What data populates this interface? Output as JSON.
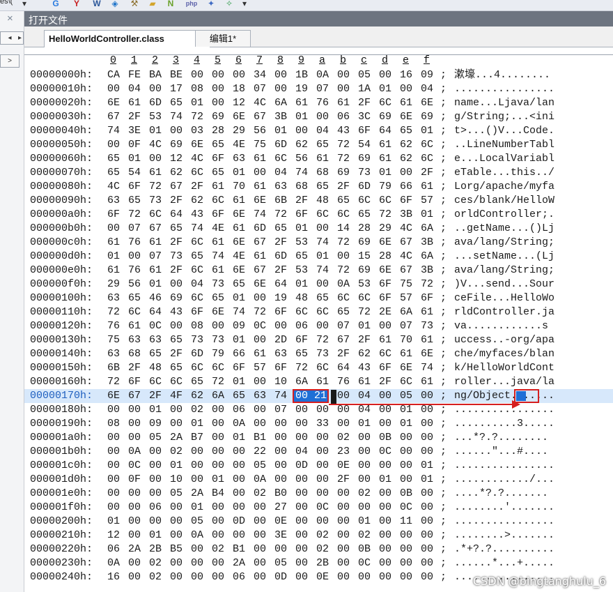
{
  "toolbar": {
    "combo_text": "es\\(",
    "icons": [
      "dropdown-arrow-icon",
      "google-icon",
      "youdao-icon",
      "word-icon",
      "ie-icon",
      "hammer-icon",
      "folder-icon",
      "n-icon",
      "php-icon",
      "plugin-icon",
      "wizard-icon",
      "dropdown-arrow-icon"
    ]
  },
  "left_strip": {
    "close_glyph": "×",
    "btn1": "◂",
    "btn2": "▸",
    "btn3": ">"
  },
  "panel": {
    "title": "打开文件"
  },
  "tabs": [
    {
      "label": "HelloWorldController.class",
      "close": "×"
    },
    {
      "label": "编辑1*"
    }
  ],
  "hex": {
    "column_headers": [
      "0",
      "1",
      "2",
      "3",
      "4",
      "5",
      "6",
      "7",
      "8",
      "9",
      "a",
      "b",
      "c",
      "d",
      "e",
      "f"
    ],
    "highlight_row": 23,
    "rows": [
      {
        "addr": "00000000h:",
        "bytes": [
          "CA",
          "FE",
          "BA",
          "BE",
          "00",
          "00",
          "00",
          "34",
          "00",
          "1B",
          "0A",
          "00",
          "05",
          "00",
          "16",
          "09"
        ],
        "ascii": "漱壕...4........"
      },
      {
        "addr": "00000010h:",
        "bytes": [
          "00",
          "04",
          "00",
          "17",
          "08",
          "00",
          "18",
          "07",
          "00",
          "19",
          "07",
          "00",
          "1A",
          "01",
          "00",
          "04"
        ],
        "ascii": "................"
      },
      {
        "addr": "00000020h:",
        "bytes": [
          "6E",
          "61",
          "6D",
          "65",
          "01",
          "00",
          "12",
          "4C",
          "6A",
          "61",
          "76",
          "61",
          "2F",
          "6C",
          "61",
          "6E"
        ],
        "ascii": "name...Ljava/lan"
      },
      {
        "addr": "00000030h:",
        "bytes": [
          "67",
          "2F",
          "53",
          "74",
          "72",
          "69",
          "6E",
          "67",
          "3B",
          "01",
          "00",
          "06",
          "3C",
          "69",
          "6E",
          "69"
        ],
        "ascii": "g/String;...<ini"
      },
      {
        "addr": "00000040h:",
        "bytes": [
          "74",
          "3E",
          "01",
          "00",
          "03",
          "28",
          "29",
          "56",
          "01",
          "00",
          "04",
          "43",
          "6F",
          "64",
          "65",
          "01"
        ],
        "ascii": "t>...()V...Code."
      },
      {
        "addr": "00000050h:",
        "bytes": [
          "00",
          "0F",
          "4C",
          "69",
          "6E",
          "65",
          "4E",
          "75",
          "6D",
          "62",
          "65",
          "72",
          "54",
          "61",
          "62",
          "6C"
        ],
        "ascii": "..LineNumberTabl"
      },
      {
        "addr": "00000060h:",
        "bytes": [
          "65",
          "01",
          "00",
          "12",
          "4C",
          "6F",
          "63",
          "61",
          "6C",
          "56",
          "61",
          "72",
          "69",
          "61",
          "62",
          "6C"
        ],
        "ascii": "e...LocalVariabl"
      },
      {
        "addr": "00000070h:",
        "bytes": [
          "65",
          "54",
          "61",
          "62",
          "6C",
          "65",
          "01",
          "00",
          "04",
          "74",
          "68",
          "69",
          "73",
          "01",
          "00",
          "2F"
        ],
        "ascii": "eTable...this../"
      },
      {
        "addr": "00000080h:",
        "bytes": [
          "4C",
          "6F",
          "72",
          "67",
          "2F",
          "61",
          "70",
          "61",
          "63",
          "68",
          "65",
          "2F",
          "6D",
          "79",
          "66",
          "61"
        ],
        "ascii": "Lorg/apache/myfa"
      },
      {
        "addr": "00000090h:",
        "bytes": [
          "63",
          "65",
          "73",
          "2F",
          "62",
          "6C",
          "61",
          "6E",
          "6B",
          "2F",
          "48",
          "65",
          "6C",
          "6C",
          "6F",
          "57"
        ],
        "ascii": "ces/blank/HelloW"
      },
      {
        "addr": "000000a0h:",
        "bytes": [
          "6F",
          "72",
          "6C",
          "64",
          "43",
          "6F",
          "6E",
          "74",
          "72",
          "6F",
          "6C",
          "6C",
          "65",
          "72",
          "3B",
          "01"
        ],
        "ascii": "orldController;."
      },
      {
        "addr": "000000b0h:",
        "bytes": [
          "00",
          "07",
          "67",
          "65",
          "74",
          "4E",
          "61",
          "6D",
          "65",
          "01",
          "00",
          "14",
          "28",
          "29",
          "4C",
          "6A"
        ],
        "ascii": "..getName...()Lj"
      },
      {
        "addr": "000000c0h:",
        "bytes": [
          "61",
          "76",
          "61",
          "2F",
          "6C",
          "61",
          "6E",
          "67",
          "2F",
          "53",
          "74",
          "72",
          "69",
          "6E",
          "67",
          "3B"
        ],
        "ascii": "ava/lang/String;"
      },
      {
        "addr": "000000d0h:",
        "bytes": [
          "01",
          "00",
          "07",
          "73",
          "65",
          "74",
          "4E",
          "61",
          "6D",
          "65",
          "01",
          "00",
          "15",
          "28",
          "4C",
          "6A"
        ],
        "ascii": "...setName...(Lj"
      },
      {
        "addr": "000000e0h:",
        "bytes": [
          "61",
          "76",
          "61",
          "2F",
          "6C",
          "61",
          "6E",
          "67",
          "2F",
          "53",
          "74",
          "72",
          "69",
          "6E",
          "67",
          "3B"
        ],
        "ascii": "ava/lang/String;"
      },
      {
        "addr": "000000f0h:",
        "bytes": [
          "29",
          "56",
          "01",
          "00",
          "04",
          "73",
          "65",
          "6E",
          "64",
          "01",
          "00",
          "0A",
          "53",
          "6F",
          "75",
          "72"
        ],
        "ascii": ")V...send...Sour"
      },
      {
        "addr": "00000100h:",
        "bytes": [
          "63",
          "65",
          "46",
          "69",
          "6C",
          "65",
          "01",
          "00",
          "19",
          "48",
          "65",
          "6C",
          "6C",
          "6F",
          "57",
          "6F"
        ],
        "ascii": "ceFile...HelloWo"
      },
      {
        "addr": "00000110h:",
        "bytes": [
          "72",
          "6C",
          "64",
          "43",
          "6F",
          "6E",
          "74",
          "72",
          "6F",
          "6C",
          "6C",
          "65",
          "72",
          "2E",
          "6A",
          "61"
        ],
        "ascii": "rldController.ja"
      },
      {
        "addr": "00000120h:",
        "bytes": [
          "76",
          "61",
          "0C",
          "00",
          "08",
          "00",
          "09",
          "0C",
          "00",
          "06",
          "00",
          "07",
          "01",
          "00",
          "07",
          "73"
        ],
        "ascii": "va............s"
      },
      {
        "addr": "00000130h:",
        "bytes": [
          "75",
          "63",
          "63",
          "65",
          "73",
          "73",
          "01",
          "00",
          "2D",
          "6F",
          "72",
          "67",
          "2F",
          "61",
          "70",
          "61"
        ],
        "ascii": "uccess..-org/apa"
      },
      {
        "addr": "00000140h:",
        "bytes": [
          "63",
          "68",
          "65",
          "2F",
          "6D",
          "79",
          "66",
          "61",
          "63",
          "65",
          "73",
          "2F",
          "62",
          "6C",
          "61",
          "6E"
        ],
        "ascii": "che/myfaces/blan"
      },
      {
        "addr": "00000150h:",
        "bytes": [
          "6B",
          "2F",
          "48",
          "65",
          "6C",
          "6C",
          "6F",
          "57",
          "6F",
          "72",
          "6C",
          "64",
          "43",
          "6F",
          "6E",
          "74"
        ],
        "ascii": "k/HelloWorldCont"
      },
      {
        "addr": "00000160h:",
        "bytes": [
          "72",
          "6F",
          "6C",
          "6C",
          "65",
          "72",
          "01",
          "00",
          "10",
          "6A",
          "61",
          "76",
          "61",
          "2F",
          "6C",
          "61"
        ],
        "ascii": "roller...java/la"
      },
      {
        "addr": "00000170h:",
        "bytes": [
          "6E",
          "67",
          "2F",
          "4F",
          "62",
          "6A",
          "65",
          "63",
          "74",
          "00",
          "21",
          "00",
          "04",
          "00",
          "05",
          "00"
        ],
        "ascii": "ng/Object.!....."
      },
      {
        "addr": "00000180h:",
        "bytes": [
          "00",
          "00",
          "01",
          "00",
          "02",
          "00",
          "06",
          "00",
          "07",
          "00",
          "00",
          "00",
          "04",
          "00",
          "01",
          "00"
        ],
        "ascii": "................"
      },
      {
        "addr": "00000190h:",
        "bytes": [
          "08",
          "00",
          "09",
          "00",
          "01",
          "00",
          "0A",
          "00",
          "00",
          "00",
          "33",
          "00",
          "01",
          "00",
          "01",
          "00"
        ],
        "ascii": "..........3....."
      },
      {
        "addr": "000001a0h:",
        "bytes": [
          "00",
          "00",
          "05",
          "2A",
          "B7",
          "00",
          "01",
          "B1",
          "00",
          "00",
          "00",
          "02",
          "00",
          "0B",
          "00",
          "00"
        ],
        "ascii": "...*?.?........"
      },
      {
        "addr": "000001b0h:",
        "bytes": [
          "00",
          "0A",
          "00",
          "02",
          "00",
          "00",
          "00",
          "22",
          "00",
          "04",
          "00",
          "23",
          "00",
          "0C",
          "00",
          "00"
        ],
        "ascii": "......\"...#...."
      },
      {
        "addr": "000001c0h:",
        "bytes": [
          "00",
          "0C",
          "00",
          "01",
          "00",
          "00",
          "00",
          "05",
          "00",
          "0D",
          "00",
          "0E",
          "00",
          "00",
          "00",
          "01"
        ],
        "ascii": "................"
      },
      {
        "addr": "000001d0h:",
        "bytes": [
          "00",
          "0F",
          "00",
          "10",
          "00",
          "01",
          "00",
          "0A",
          "00",
          "00",
          "00",
          "2F",
          "00",
          "01",
          "00",
          "01"
        ],
        "ascii": "............/..."
      },
      {
        "addr": "000001e0h:",
        "bytes": [
          "00",
          "00",
          "00",
          "05",
          "2A",
          "B4",
          "00",
          "02",
          "B0",
          "00",
          "00",
          "00",
          "02",
          "00",
          "0B",
          "00"
        ],
        "ascii": "....*?.?......."
      },
      {
        "addr": "000001f0h:",
        "bytes": [
          "00",
          "00",
          "06",
          "00",
          "01",
          "00",
          "00",
          "00",
          "27",
          "00",
          "0C",
          "00",
          "00",
          "00",
          "0C",
          "00"
        ],
        "ascii": "........'......."
      },
      {
        "addr": "00000200h:",
        "bytes": [
          "01",
          "00",
          "00",
          "00",
          "05",
          "00",
          "0D",
          "00",
          "0E",
          "00",
          "00",
          "00",
          "01",
          "00",
          "11",
          "00"
        ],
        "ascii": "................"
      },
      {
        "addr": "00000210h:",
        "bytes": [
          "12",
          "00",
          "01",
          "00",
          "0A",
          "00",
          "00",
          "00",
          "3E",
          "00",
          "02",
          "00",
          "02",
          "00",
          "00",
          "00"
        ],
        "ascii": "........>......."
      },
      {
        "addr": "00000220h:",
        "bytes": [
          "06",
          "2A",
          "2B",
          "B5",
          "00",
          "02",
          "B1",
          "00",
          "00",
          "00",
          "02",
          "00",
          "0B",
          "00",
          "00",
          "00"
        ],
        "ascii": ".*+?.?.........."
      },
      {
        "addr": "00000230h:",
        "bytes": [
          "0A",
          "00",
          "02",
          "00",
          "00",
          "00",
          "2A",
          "00",
          "05",
          "00",
          "2B",
          "00",
          "0C",
          "00",
          "00",
          "00"
        ],
        "ascii": "......*...+....."
      },
      {
        "addr": "00000240h:",
        "bytes": [
          "16",
          "00",
          "02",
          "00",
          "00",
          "00",
          "06",
          "00",
          "0D",
          "00",
          "0E",
          "00",
          "00",
          "00",
          "00",
          "00"
        ],
        "ascii": "................"
      }
    ]
  },
  "watermark": "CSDN @bingtanghulu_6",
  "colors": {
    "selection": "#1f6fd6",
    "annotation": "#d61f1f",
    "highlight_row": "#d7e8fb"
  }
}
